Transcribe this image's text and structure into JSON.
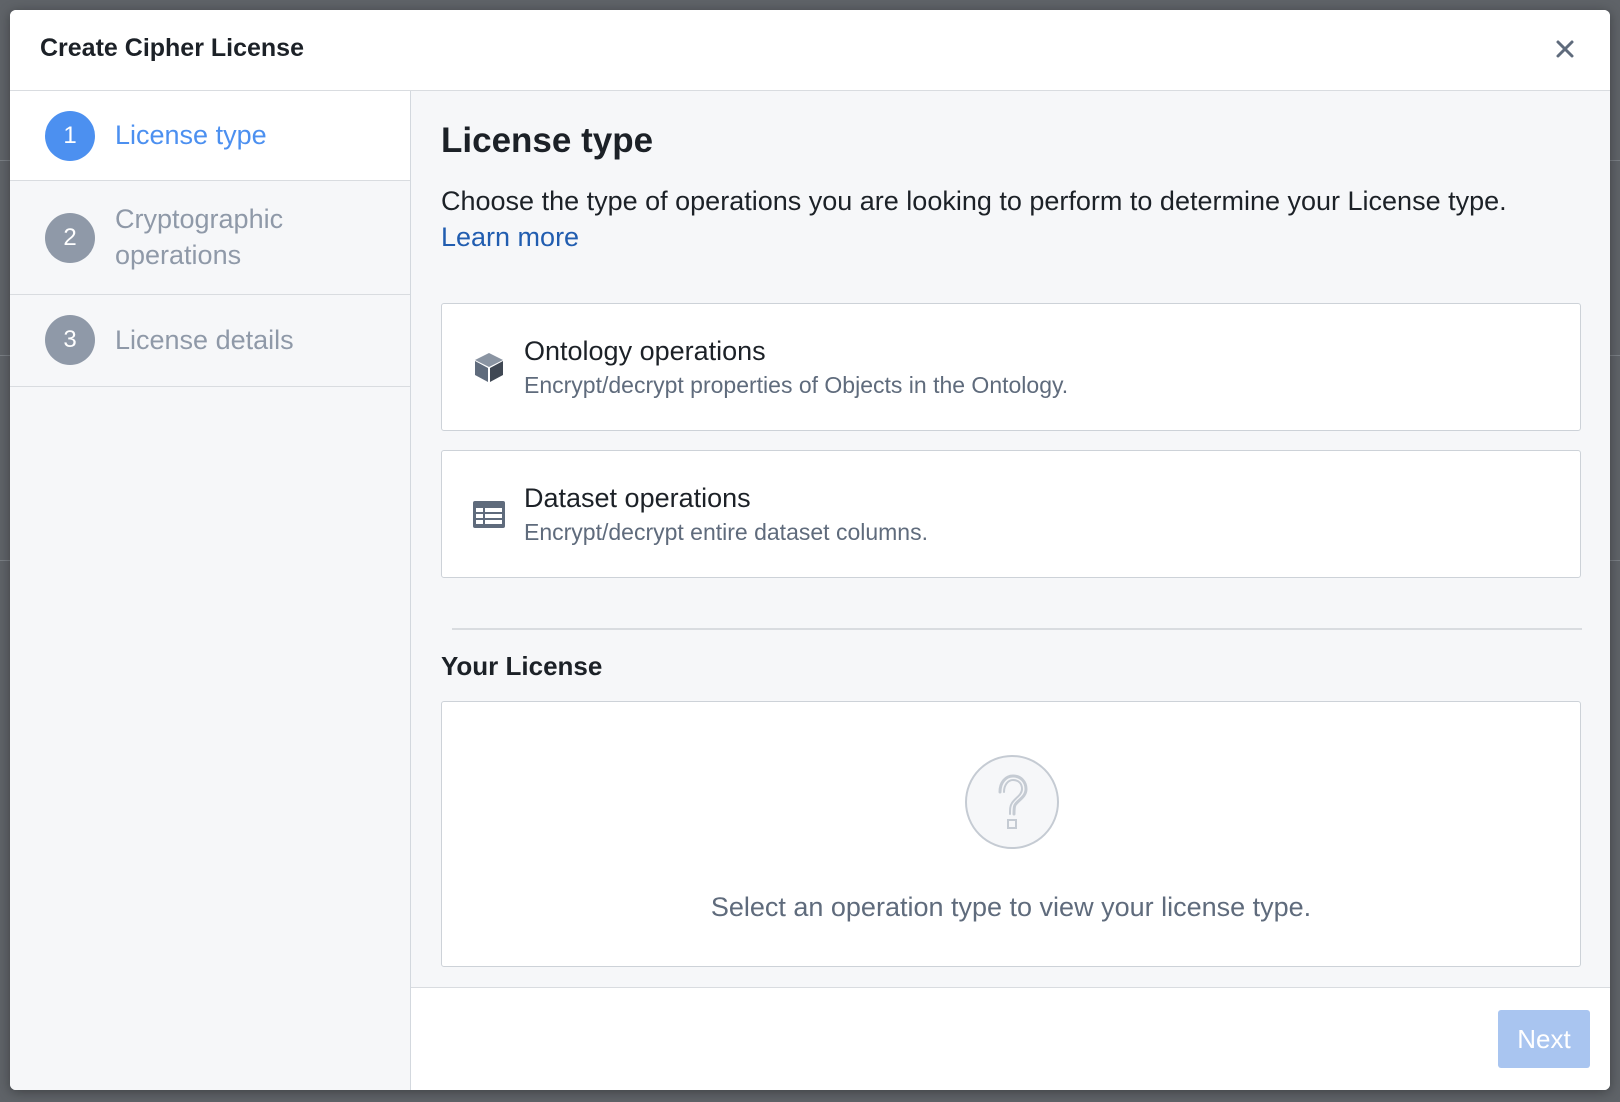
{
  "dialog": {
    "title": "Create Cipher License"
  },
  "steps": [
    {
      "number": "1",
      "label": "License type",
      "state": "active"
    },
    {
      "number": "2",
      "label": "Cryptographic operations",
      "state": "inactive"
    },
    {
      "number": "3",
      "label": "License details",
      "state": "inactive"
    }
  ],
  "main": {
    "title": "License type",
    "description": "Choose the type of operations you are looking to perform to determine your License type.",
    "learn_more_link": "Learn more",
    "operations": [
      {
        "icon": "cube-icon",
        "title": "Ontology operations",
        "description": "Encrypt/decrypt properties of Objects in the Ontology."
      },
      {
        "icon": "table-icon",
        "title": "Dataset operations",
        "description": "Encrypt/decrypt entire dataset columns."
      }
    ],
    "your_license": {
      "heading": "Your License",
      "empty_icon": "question-icon",
      "empty_text": "Select an operation type to view your license type."
    }
  },
  "footer": {
    "next_label": "Next",
    "next_disabled": true
  },
  "colors": {
    "accent": "#4c90f0",
    "link": "#215db0",
    "disabled_button": "#a9c5f0",
    "inactive_step": "#8f99a8"
  }
}
